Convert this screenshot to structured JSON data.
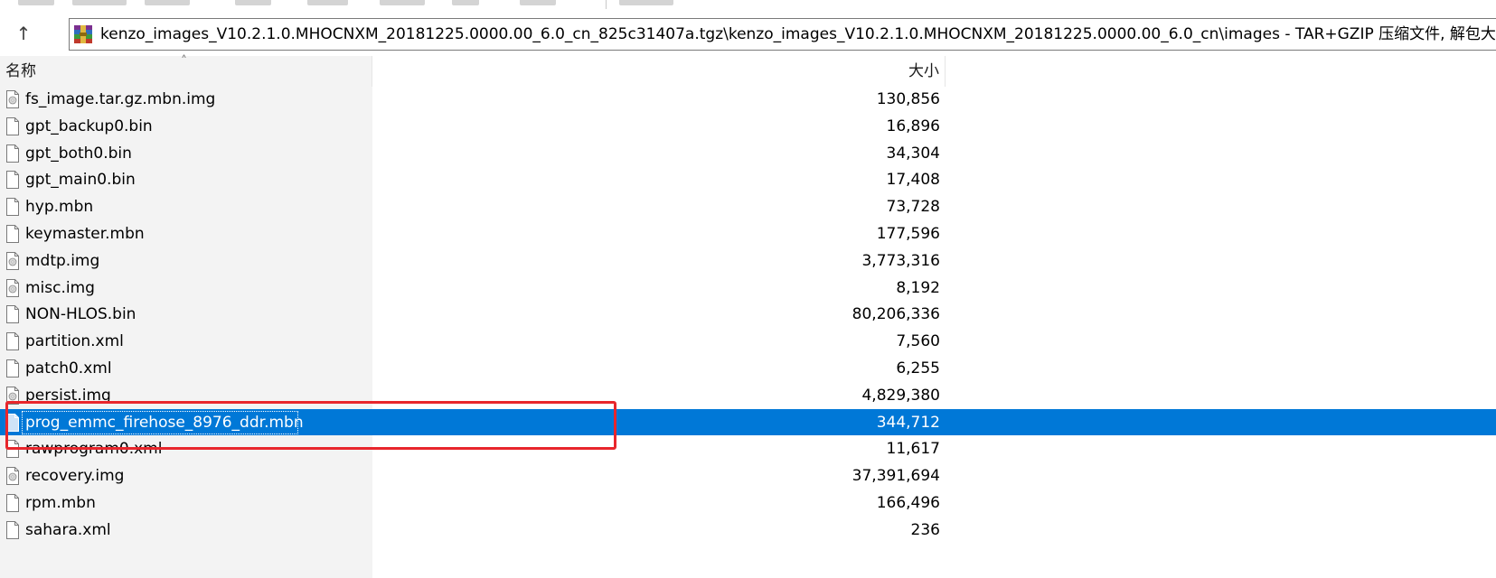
{
  "address_bar": {
    "path": "kenzo_images_V10.2.1.0.MHOCNXM_20181225.0000.00_6.0_cn_825c31407a.tgz\\kenzo_images_V10.2.1.0.MHOCNXM_20181225.0000.00_6.0_cn\\images - TAR+GZIP 压缩文件, 解包大"
  },
  "nav": {
    "up_glyph": "↑"
  },
  "columns": {
    "name": "名称",
    "size": "大小"
  },
  "files": [
    {
      "name": "fs_image.tar.gz.mbn.img",
      "size": "130,856",
      "icon": "disk-image-file-icon"
    },
    {
      "name": "gpt_backup0.bin",
      "size": "16,896",
      "icon": "blank-file-icon"
    },
    {
      "name": "gpt_both0.bin",
      "size": "34,304",
      "icon": "blank-file-icon"
    },
    {
      "name": "gpt_main0.bin",
      "size": "17,408",
      "icon": "blank-file-icon"
    },
    {
      "name": "hyp.mbn",
      "size": "73,728",
      "icon": "blank-file-icon"
    },
    {
      "name": "keymaster.mbn",
      "size": "177,596",
      "icon": "blank-file-icon"
    },
    {
      "name": "mdtp.img",
      "size": "3,773,316",
      "icon": "disk-image-file-icon"
    },
    {
      "name": "misc.img",
      "size": "8,192",
      "icon": "disk-image-file-icon"
    },
    {
      "name": "NON-HLOS.bin",
      "size": "80,206,336",
      "icon": "blank-file-icon"
    },
    {
      "name": "partition.xml",
      "size": "7,560",
      "icon": "blank-file-icon"
    },
    {
      "name": "patch0.xml",
      "size": "6,255",
      "icon": "blank-file-icon"
    },
    {
      "name": "persist.img",
      "size": "4,829,380",
      "icon": "disk-image-file-icon"
    },
    {
      "name": "prog_emmc_firehose_8976_ddr.mbn",
      "size": "344,712",
      "icon": "blank-file-icon",
      "selected": true
    },
    {
      "name": "rawprogram0.xml",
      "size": "11,617",
      "icon": "blank-file-icon"
    },
    {
      "name": "recovery.img",
      "size": "37,391,694",
      "icon": "disk-image-file-icon"
    },
    {
      "name": "rpm.mbn",
      "size": "166,496",
      "icon": "blank-file-icon"
    },
    {
      "name": "sahara.xml",
      "size": "236",
      "icon": "blank-file-icon"
    }
  ],
  "colors": {
    "selection": "#0078d7",
    "highlight": "#e8262c"
  }
}
